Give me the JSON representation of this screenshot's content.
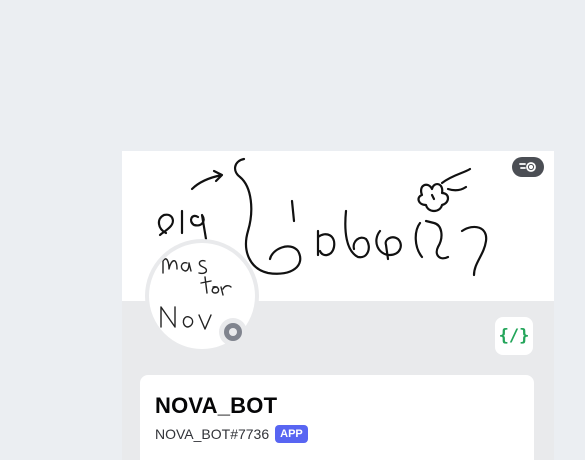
{
  "profile": {
    "banner_text": "ยังไม่เสร็จ",
    "avatar_text": "Master Nova",
    "status": "offline",
    "username": "NOVA_BOT",
    "tag": "NOVA_BOT#7736",
    "app_badge": "APP",
    "dev_badge_glyph": "{/}",
    "icons": {
      "banner_toggle": "eye-toggle-icon",
      "developer": "developer-badge-icon"
    },
    "colors": {
      "app_badge": "#5865f2",
      "dev_badge": "#23a55a",
      "status_offline": "#80848e"
    }
  }
}
